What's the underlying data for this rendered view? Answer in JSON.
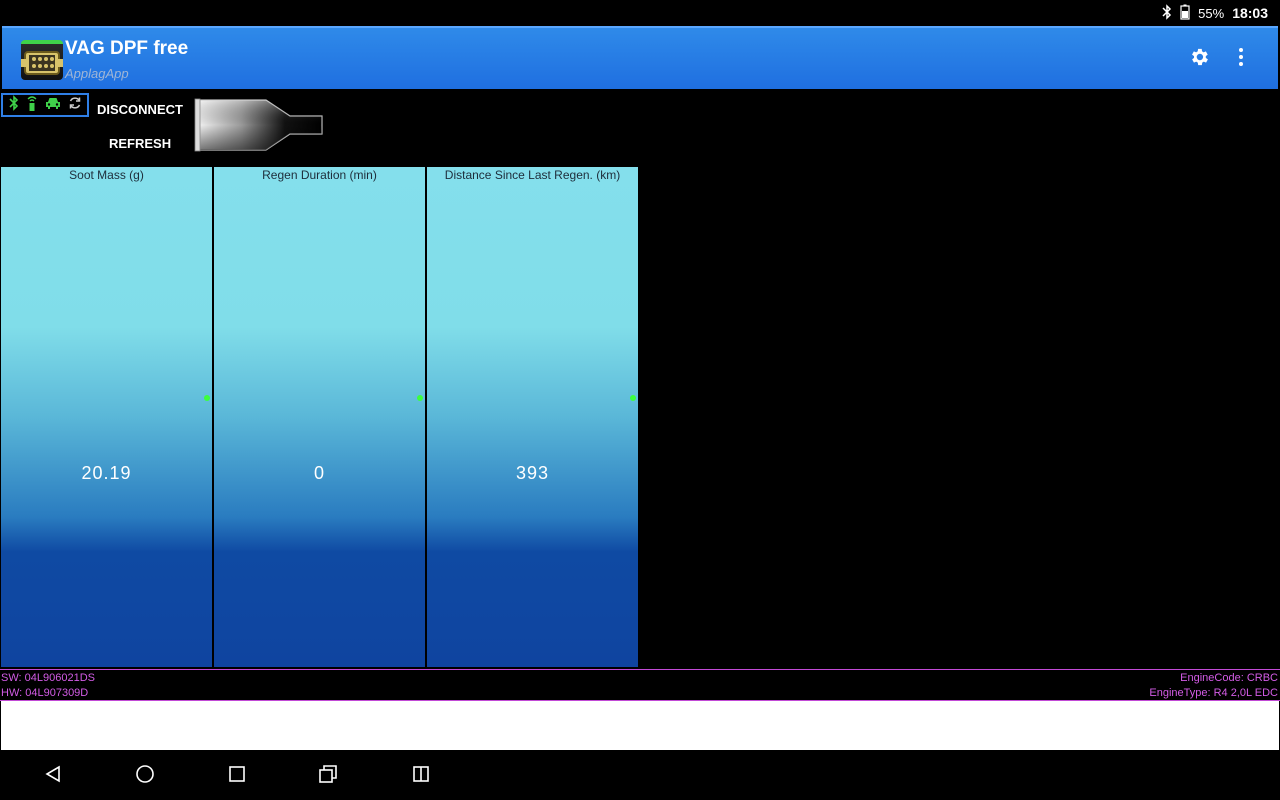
{
  "status_bar": {
    "icons": [
      "bluetooth-icon",
      "battery-icon"
    ],
    "battery": "55%",
    "time": "18:03"
  },
  "app_bar": {
    "title": "VAG DPF free",
    "subtitle": "ApplagApp",
    "actions": [
      "settings-icon",
      "overflow-menu-icon"
    ]
  },
  "connection": {
    "status_icons": [
      "bluetooth-icon",
      "obd-adapter-icon",
      "car-icon",
      "sync-icon"
    ],
    "status_color": "#3fd24a",
    "disconnect_label": "DISCONNECT",
    "refresh_label": "REFRESH"
  },
  "gauges": [
    {
      "label": "Soot Mass (g)",
      "value": "20.19"
    },
    {
      "label": "Regen Duration (min)",
      "value": "0"
    },
    {
      "label": "Distance Since Last Regen. (km)",
      "value": "393"
    }
  ],
  "ecu_info": {
    "sw": "SW: 04L906021DS",
    "hw": "HW: 04L907309D",
    "engine_code": "EngineCode: CRBC",
    "engine_type": "EngineType: R4 2,0L EDC"
  },
  "colors": {
    "appbar": "#1f6fe0",
    "info_text": "#d35ce6",
    "indicator_dot": "#3cff3c"
  },
  "nav_bar": [
    "back-icon",
    "home-icon",
    "recents-icon",
    "screenshot-icon",
    "split-screen-icon"
  ]
}
